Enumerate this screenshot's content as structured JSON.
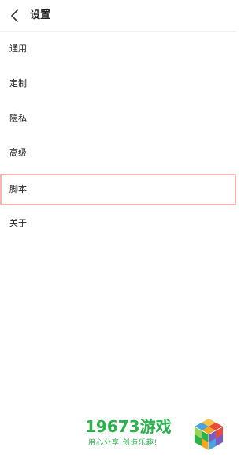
{
  "header": {
    "title": "设置",
    "back_icon": "chevron-left-icon"
  },
  "menu": {
    "items": [
      {
        "label": "通用",
        "highlighted": false
      },
      {
        "label": "定制",
        "highlighted": false
      },
      {
        "label": "隐私",
        "highlighted": false
      },
      {
        "label": "高级",
        "highlighted": false
      },
      {
        "label": "脚本",
        "highlighted": true
      },
      {
        "label": "关于",
        "highlighted": false
      }
    ]
  },
  "watermark": {
    "title": "19673游戏",
    "slogan": "用心分享 创造乐趣!",
    "logo_icon": "cube-logo-icon"
  },
  "colors": {
    "highlight_border": "#f5b5b5",
    "watermark_green": "#2bb24c"
  }
}
